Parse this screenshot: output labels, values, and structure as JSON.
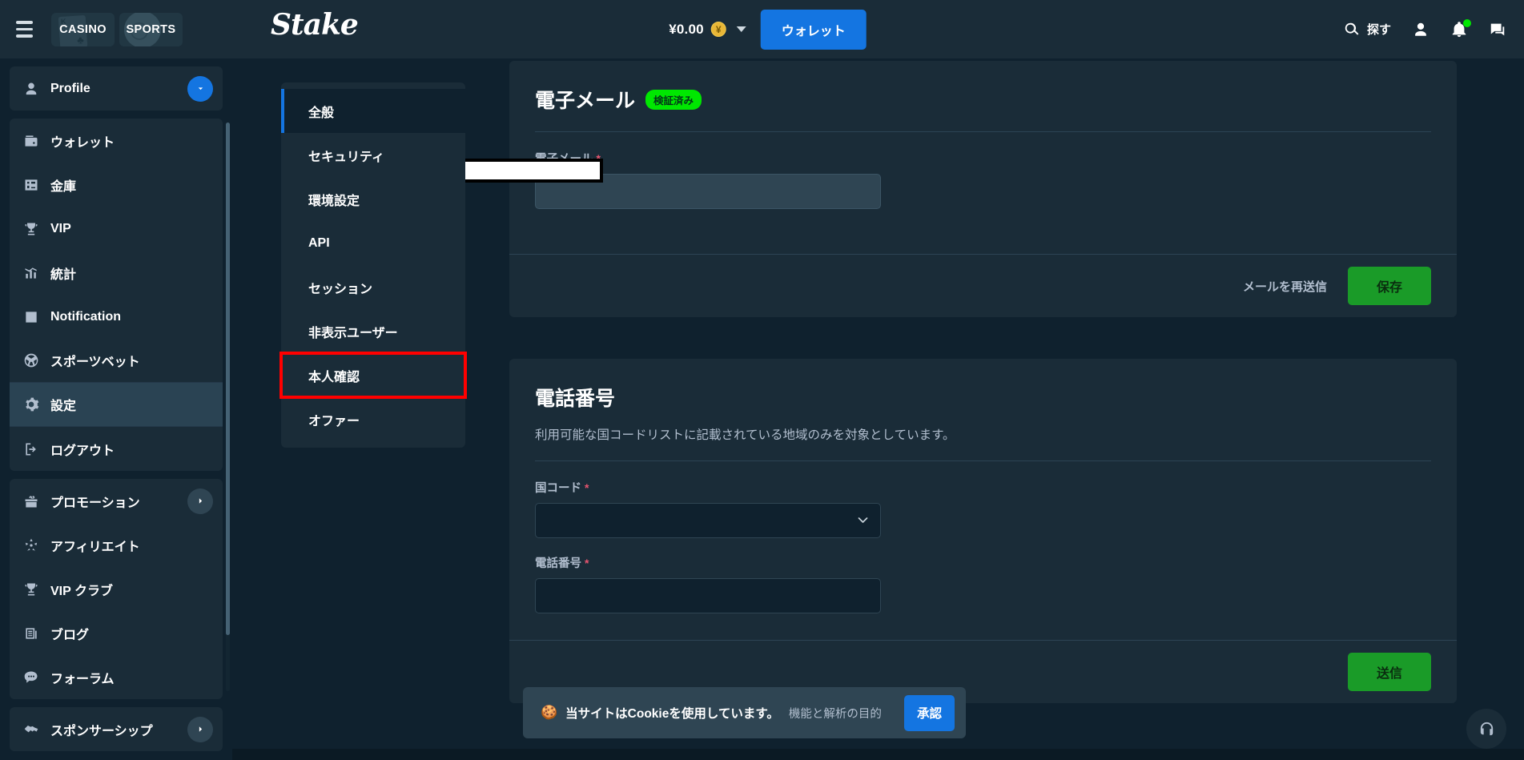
{
  "header": {
    "menu_icon": "hamburger-icon",
    "pills": [
      {
        "label": "CASINO",
        "icon": "playing-card-icon"
      },
      {
        "label": "SPORTS",
        "icon": "soccer-ball-icon"
      }
    ],
    "logo": "Stake",
    "balance": {
      "amount": "¥0.00",
      "currency_icon": "yen-coin-icon"
    },
    "wallet_button": "ウォレット",
    "search_label": "探す",
    "icons": [
      "search-icon",
      "user-icon",
      "bell-icon",
      "chat-icon"
    ],
    "notification_dot_color": "#00e701"
  },
  "sidebar": {
    "profile": {
      "label": "Profile",
      "icon": "user-icon"
    },
    "group1": [
      {
        "label": "ウォレット",
        "icon": "wallet-icon"
      },
      {
        "label": "金庫",
        "icon": "vault-icon"
      },
      {
        "label": "VIP",
        "icon": "trophy-icon"
      },
      {
        "label": "統計",
        "icon": "stats-icon"
      },
      {
        "label": "Notification",
        "icon": "list-check-icon"
      },
      {
        "label": "スポーツベット",
        "icon": "sports-icon"
      },
      {
        "label": "設定",
        "icon": "gear-icon",
        "active": true
      },
      {
        "label": "ログアウト",
        "icon": "logout-icon"
      }
    ],
    "group2": [
      {
        "label": "プロモーション",
        "icon": "gift-icon",
        "chevron": true
      },
      {
        "label": "アフィリエイト",
        "icon": "affiliate-icon"
      },
      {
        "label": "VIP クラブ",
        "icon": "trophy-icon"
      },
      {
        "label": "ブログ",
        "icon": "blog-icon"
      },
      {
        "label": "フォーラム",
        "icon": "forum-icon"
      }
    ],
    "group3": [
      {
        "label": "スポンサーシップ",
        "icon": "handshake-icon",
        "chevron": true
      }
    ]
  },
  "settings_nav": [
    {
      "label": "全般",
      "active": true
    },
    {
      "label": "セキュリティ"
    },
    {
      "label": "環境設定"
    },
    {
      "label": "API"
    },
    {
      "label": "セッション"
    },
    {
      "label": "非表示ユーザー"
    },
    {
      "label": "本人確認",
      "highlighted": true
    },
    {
      "label": "オファー"
    }
  ],
  "email_panel": {
    "title": "電子メール",
    "badge": "検証済み",
    "field_label": "電子メール",
    "required_mark": "*",
    "field_value": "",
    "resend_label": "メールを再送信",
    "save_label": "保存"
  },
  "phone_panel": {
    "title": "電話番号",
    "description": "利用可能な国コードリストに記載されている地域のみを対象としています。",
    "country_label": "国コード",
    "country_value": "",
    "phone_label": "電話番号",
    "phone_value": "",
    "required_mark": "*",
    "submit_label": "送信"
  },
  "cookie_banner": {
    "emoji": "🍪",
    "text_main": "当サイトはCookieを使用しています。",
    "text_sub": "機能と解析の目的",
    "accept_label": "承認"
  },
  "support": {
    "icon": "headset-icon"
  },
  "colors": {
    "bg": "#0f212e",
    "panel": "#1a2c38",
    "accent_blue": "#1475e1",
    "accent_green": "#00e701",
    "button_green": "#1a9b28",
    "highlight_red": "#ff0000",
    "muted_text": "#b1bece"
  }
}
